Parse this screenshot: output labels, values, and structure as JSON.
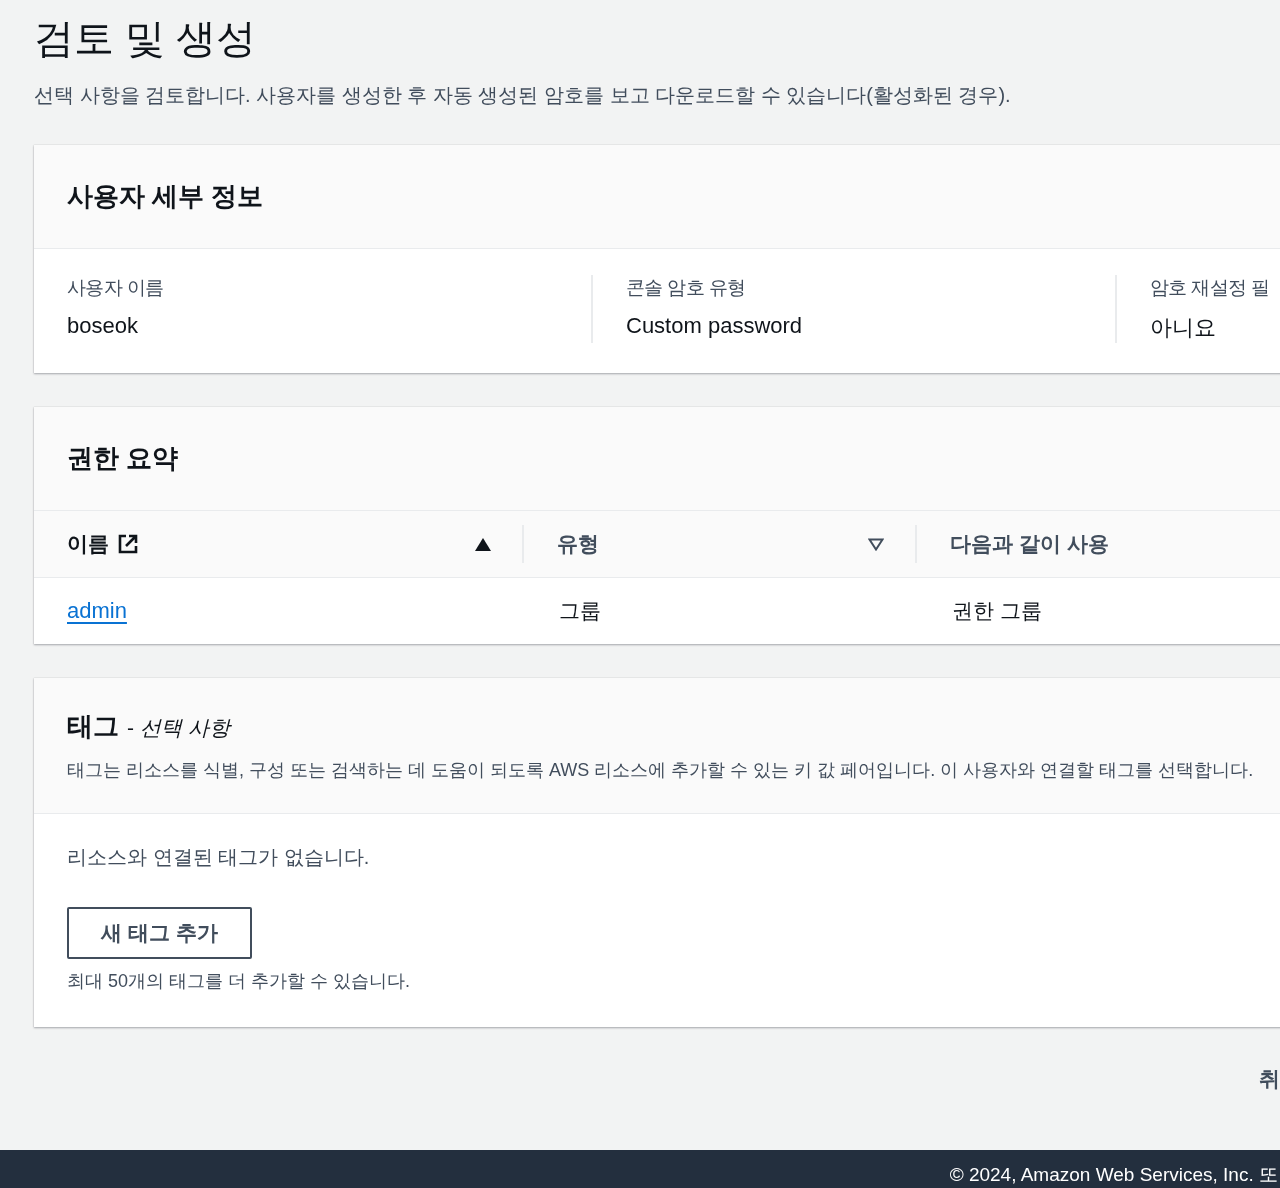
{
  "page": {
    "title": "검토 및 생성",
    "description": "선택 사항을 검토합니다. 사용자를 생성한 후 자동 생성된 암호를 보고 다운로드할 수 있습니다(활성화된 경우)."
  },
  "user_details": {
    "heading": "사용자 세부 정보",
    "fields": [
      {
        "label": "사용자 이름",
        "value": "boseok"
      },
      {
        "label": "콘솔 암호 유형",
        "value": "Custom password"
      },
      {
        "label": "암호 재설정 필",
        "value": "아니요"
      }
    ]
  },
  "permissions": {
    "heading": "권한 요약",
    "columns": [
      {
        "label": "이름",
        "external_link": true,
        "sorted_ascending": true
      },
      {
        "label": "유형",
        "external_link": false,
        "sorted_ascending": false
      },
      {
        "label": "다음과 같이 사용",
        "external_link": false
      }
    ],
    "rows": [
      {
        "name": "admin",
        "type": "그룹",
        "used_as": "권한 그룹"
      }
    ]
  },
  "tags": {
    "heading": "태그",
    "optional": "- *선택 사항*",
    "description": "태그는 리소스를 식별, 구성 또는 검색하는 데 도움이 되도록 AWS 리소스에 추가할 수 있는 키 값 페어입니다. 이 사용자와 연결할 태그를 선택합니다.",
    "empty_message": "리소스와 연결된 태그가 없습니다.",
    "add_button": "새 태그 추가",
    "limit_note": "최대 50개의 태그를 더 추가할 수 있습니다."
  },
  "actions": {
    "cancel": "취"
  },
  "footer": {
    "copyright": "© 2024, Amazon Web Services, Inc. 또"
  }
}
